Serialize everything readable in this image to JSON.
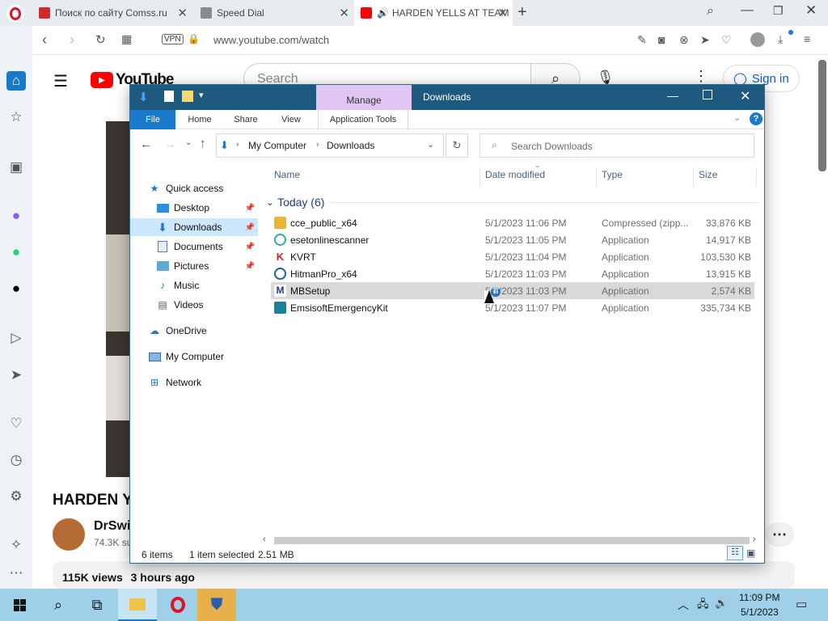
{
  "browser": {
    "tabs": [
      {
        "title": "Поиск по сайту Comss.ru"
      },
      {
        "title": "Speed Dial"
      },
      {
        "title": "HARDEN YELLS AT TEAM"
      }
    ],
    "address": "www.youtube.com/watch",
    "vpn_label": "VPN"
  },
  "youtube": {
    "search_placeholder": "Search",
    "sign_in": "Sign in",
    "logo_text": "YouTube",
    "video_title": "HARDEN Y",
    "channel_name": "DrSwis",
    "subscribers": "74.3K su",
    "views": "115K views",
    "time_ago": "3 hours ago",
    "more_label": "⋯"
  },
  "explorer": {
    "window_title": "Downloads",
    "manage_label": "Manage",
    "ribbon_tabs": [
      "File",
      "Home",
      "Share",
      "View",
      "Application Tools"
    ],
    "breadcrumb": [
      "My Computer",
      "Downloads"
    ],
    "search_placeholder": "Search Downloads",
    "nav": {
      "quick_access": "Quick access",
      "items": [
        "Desktop",
        "Downloads",
        "Documents",
        "Pictures",
        "Music",
        "Videos"
      ],
      "onedrive": "OneDrive",
      "my_computer": "My Computer",
      "network": "Network"
    },
    "columns": [
      "Name",
      "Date modified",
      "Type",
      "Size"
    ],
    "group_label": "Today (6)",
    "files": [
      {
        "name": "cce_public_x64",
        "date": "5/1/2023 11:06 PM",
        "type": "Compressed (zipp...",
        "size": "33,876 KB",
        "color": "#e8b634"
      },
      {
        "name": "esetonlinescanner",
        "date": "5/1/2023 11:05 PM",
        "type": "Application",
        "size": "14,917 KB",
        "color": "#38a7a4"
      },
      {
        "name": "KVRT",
        "date": "5/1/2023 11:04 PM",
        "type": "Application",
        "size": "103,530 KB",
        "color": "#d0202a"
      },
      {
        "name": "HitmanPro_x64",
        "date": "5/1/2023 11:03 PM",
        "type": "Application",
        "size": "13,915 KB",
        "color": "#1e5aa8"
      },
      {
        "name": "MBSetup",
        "date": "5/1/2023 11:03 PM",
        "type": "Application",
        "size": "2,574 KB",
        "color": "#1d3f8f"
      },
      {
        "name": "EmsisoftEmergencyKit",
        "date": "5/1/2023 11:07 PM",
        "type": "Application",
        "size": "335,734 KB",
        "color": "#1b7f9e"
      }
    ],
    "status": {
      "items": "6 items",
      "selected": "1 item selected",
      "size": "2.51 MB"
    }
  },
  "taskbar": {
    "time": "11:09 PM",
    "date": "5/1/2023"
  },
  "colors": {
    "accent": "#1979ca",
    "manage_tab": "#e1c6f5",
    "title_bar": "#1e5a80",
    "taskbar": "#9fd0ea",
    "selected_row": "#d9d9d9"
  }
}
